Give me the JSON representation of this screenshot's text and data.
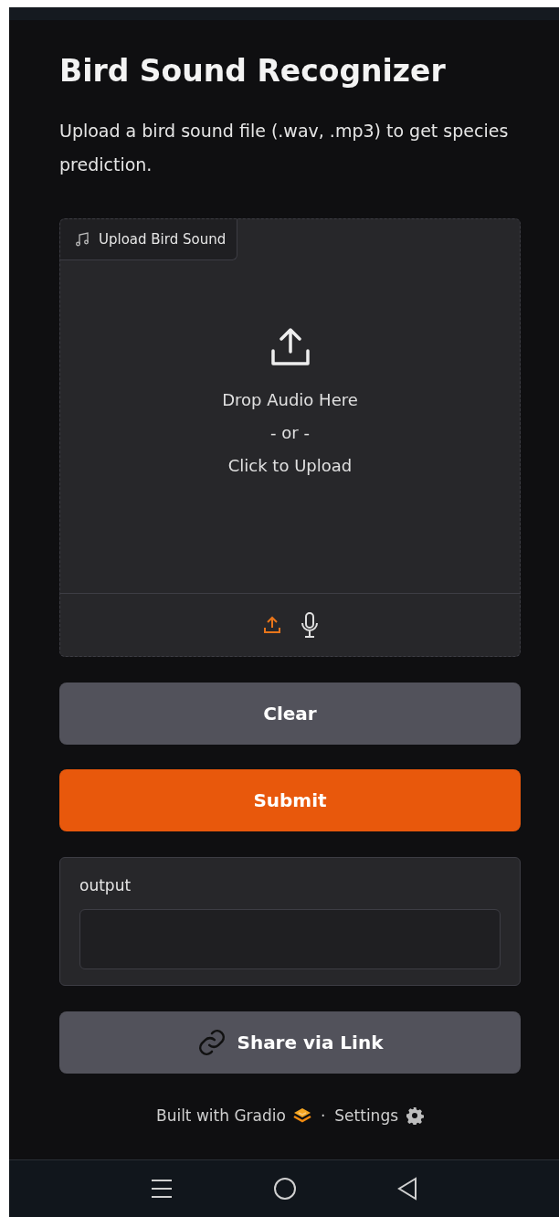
{
  "title": "Bird Sound Recognizer",
  "description": "Upload a bird sound file (.wav, .mp3) to get species prediction.",
  "upload": {
    "label": "Upload Bird Sound",
    "drop_text": "Drop Audio Here",
    "or_text": "- or -",
    "click_text": "Click to Upload",
    "sources": [
      {
        "kind": "upload",
        "selected": true
      },
      {
        "kind": "microphone",
        "selected": false
      }
    ]
  },
  "buttons": [
    {
      "label": "Clear",
      "kind": "secondary"
    },
    {
      "label": "Submit",
      "kind": "primary"
    }
  ],
  "output": {
    "label": "output"
  },
  "share_button": {
    "label": "Share via Link"
  },
  "footer": {
    "built_with": "Built with Gradio",
    "separator": "·",
    "settings": "Settings"
  },
  "nav_bar": [
    {
      "kind": "menu"
    },
    {
      "kind": "home"
    },
    {
      "kind": "back"
    }
  ]
}
